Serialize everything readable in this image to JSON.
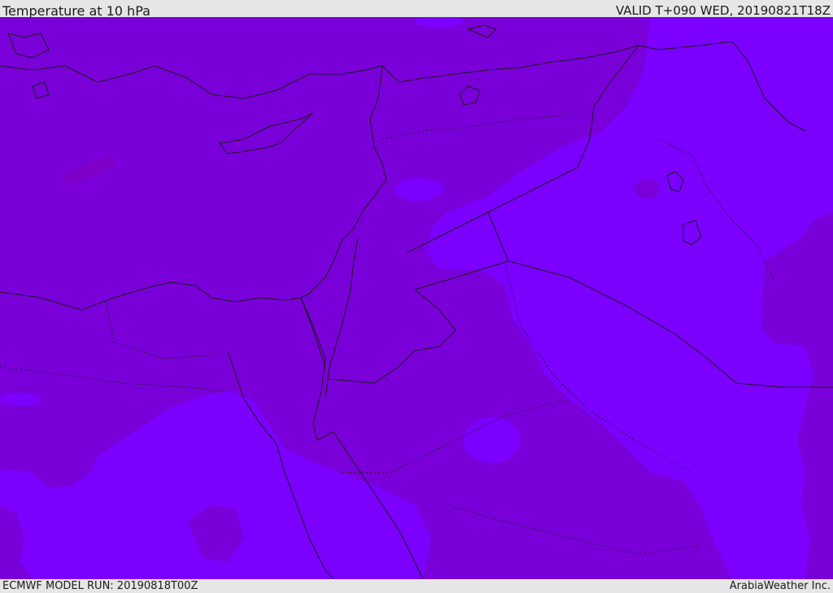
{
  "header": {
    "title": "Temperature at 10 hPa",
    "valid": "VALID T+090 WED, 20190821T18Z"
  },
  "footer": {
    "model_run": "ECMWF MODEL RUN: 20190818T00Z",
    "credit": "ArabiaWeather Inc."
  },
  "map": {
    "colors": {
      "warm_field": "#7a00d9",
      "cool_field": "#7b00ff",
      "warmer_patch": "#7e00c8",
      "border": "#1a1a1a"
    }
  }
}
